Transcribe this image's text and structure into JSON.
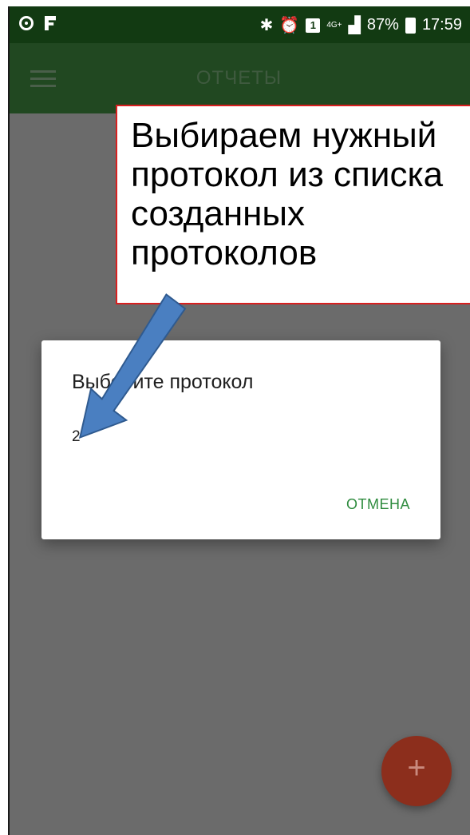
{
  "status_bar": {
    "network": "4G+",
    "battery": "87%",
    "time": "17:59"
  },
  "app_bar": {
    "title": "ОТЧЕТЫ"
  },
  "callout": {
    "text": "Выбираем нужный\nпротокол из списка\nсозданных\nпротоколов"
  },
  "dialog": {
    "title": "Выберите протокол",
    "items": [
      "2"
    ],
    "cancel_label": "ОТМЕНА"
  },
  "fab": {
    "label": "+"
  },
  "colors": {
    "status_bar": "#123a12",
    "app_bar": "#214821",
    "scrim": "#6b6b6b",
    "accent": "#2e8b3e",
    "fab": "#8c2e1c",
    "callout_border": "#d81f1f",
    "arrow": "#4a7fc1"
  },
  "icons": [
    "wifi-call-icon",
    "flag-icon",
    "bluetooth-icon",
    "alarm-icon",
    "notification-box-icon",
    "signal-icon",
    "battery-icon",
    "menu-icon",
    "plus-icon",
    "arrow-annotation-icon"
  ]
}
